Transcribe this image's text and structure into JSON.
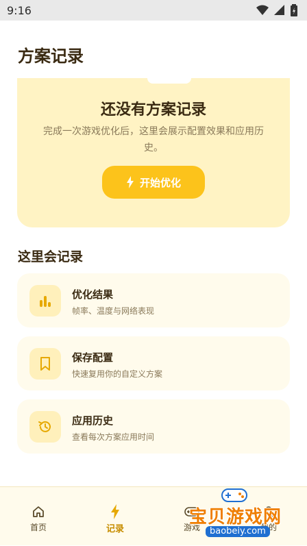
{
  "status_bar": {
    "time": "9:16"
  },
  "page": {
    "title": "方案记录"
  },
  "empty_state": {
    "title": "还没有方案记录",
    "description": "完成一次游戏优化后，这里会展示配置效果和应用历史。",
    "button_label": "开始优化",
    "button_icon": "lightning-icon"
  },
  "section": {
    "title": "这里会记录"
  },
  "features": [
    {
      "title": "优化结果",
      "desc": "帧率、温度与网络表现",
      "icon": "bar-chart-icon"
    },
    {
      "title": "保存配置",
      "desc": "快速复用你的自定义方案",
      "icon": "bookmark-icon"
    },
    {
      "title": "应用历史",
      "desc": "查看每次方案应用时间",
      "icon": "history-icon"
    }
  ],
  "nav": {
    "items": [
      {
        "label": "首页",
        "icon": "home-icon"
      },
      {
        "label": "记录",
        "icon": "lightning-icon"
      },
      {
        "label": "游戏",
        "icon": "gamepad-icon"
      },
      {
        "label": "我的",
        "icon": "profile-icon"
      }
    ],
    "active_index": 1
  },
  "watermark": {
    "text": "宝贝游戏网",
    "url": "baobeiy.com"
  },
  "colors": {
    "accent": "#fcc31b",
    "card_bg": "#fff3c4",
    "feature_bg": "#fffbec",
    "active_nav": "#c78d00"
  }
}
